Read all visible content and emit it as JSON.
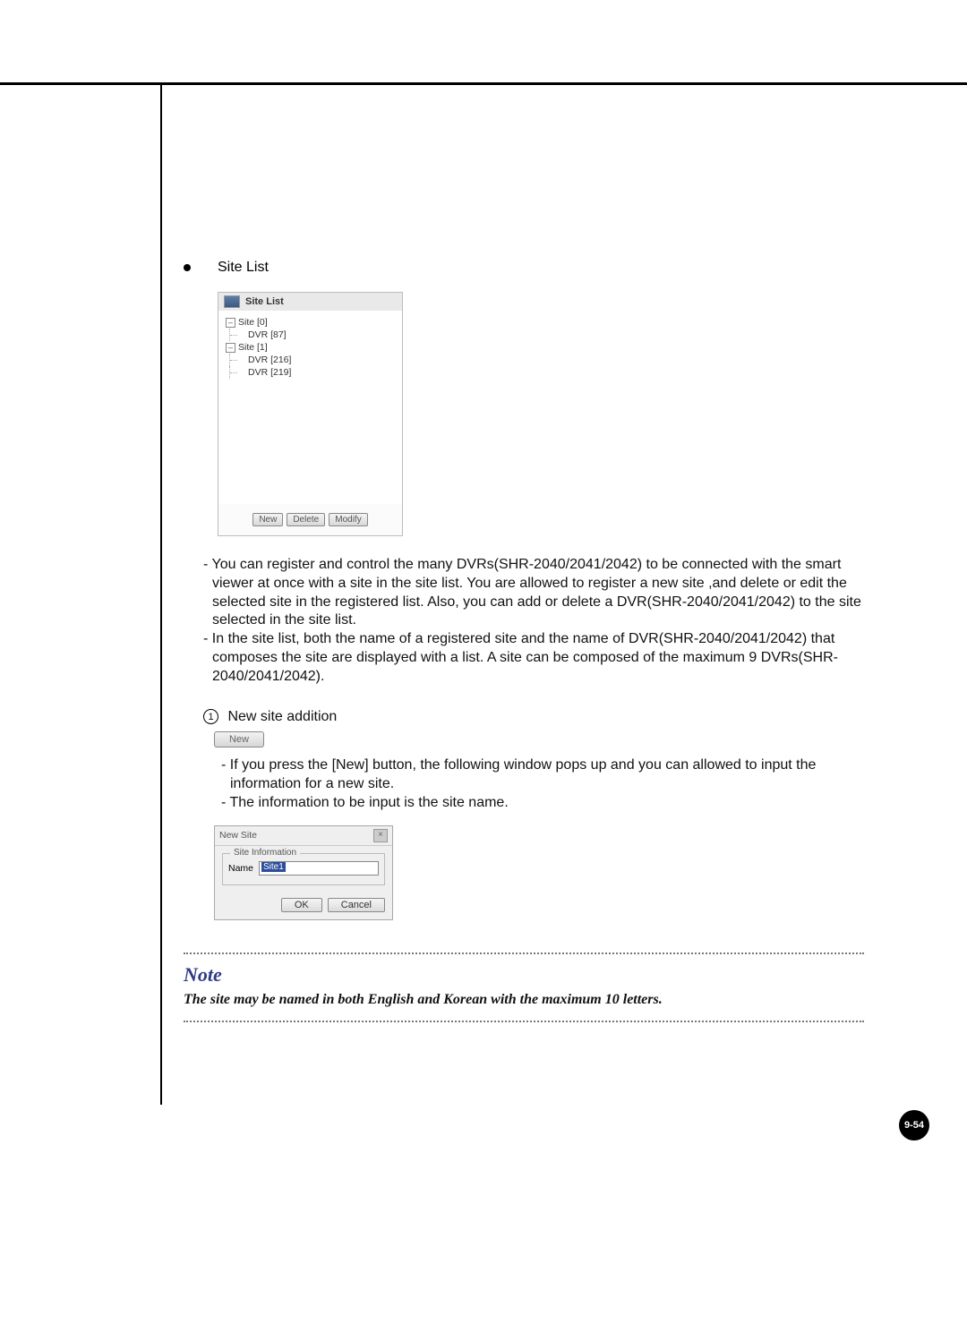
{
  "heading": "Site List",
  "panel": {
    "title": "Site List",
    "buttons": {
      "new": "New",
      "delete": "Delete",
      "modify": "Modify"
    },
    "tree": {
      "site0": "Site [0]",
      "site0_dvr87": "DVR [87]",
      "site1": "Site [1]",
      "site1_dvr216": "DVR [216]",
      "site1_dvr219": "DVR [219]"
    }
  },
  "desc": {
    "p1": "- You can register and control the many DVRs(SHR-2040/2041/2042) to be connected with the smart viewer at once with a site in the site list. You are allowed to register a new site ,and delete or edit the selected site in the registered list. Also, you can add or delete a DVR(SHR-2040/2041/2042) to the site selected in the site list.",
    "p2": "- In the site list, both the name of a registered site and the name of DVR(SHR-2040/2041/2042) that composes the site are displayed with a list. A site can be composed of the maximum 9 DVRs(SHR-2040/2041/2042)."
  },
  "step1": {
    "num": "1",
    "title": "New site addition",
    "btn": "New",
    "p1": "- If you press the [New] button, the following window pops up and you can allowed to input the information for a new site.",
    "p2": "- The information to be input is the site name."
  },
  "dialog": {
    "title": "New Site",
    "legend": "Site Information",
    "name_label": "Name",
    "name_value": "Site1",
    "ok": "OK",
    "cancel": "Cancel"
  },
  "note": {
    "title": "Note",
    "text": "The site may be named in both English and Korean with the maximum 10 letters."
  },
  "page_number": "9-54"
}
